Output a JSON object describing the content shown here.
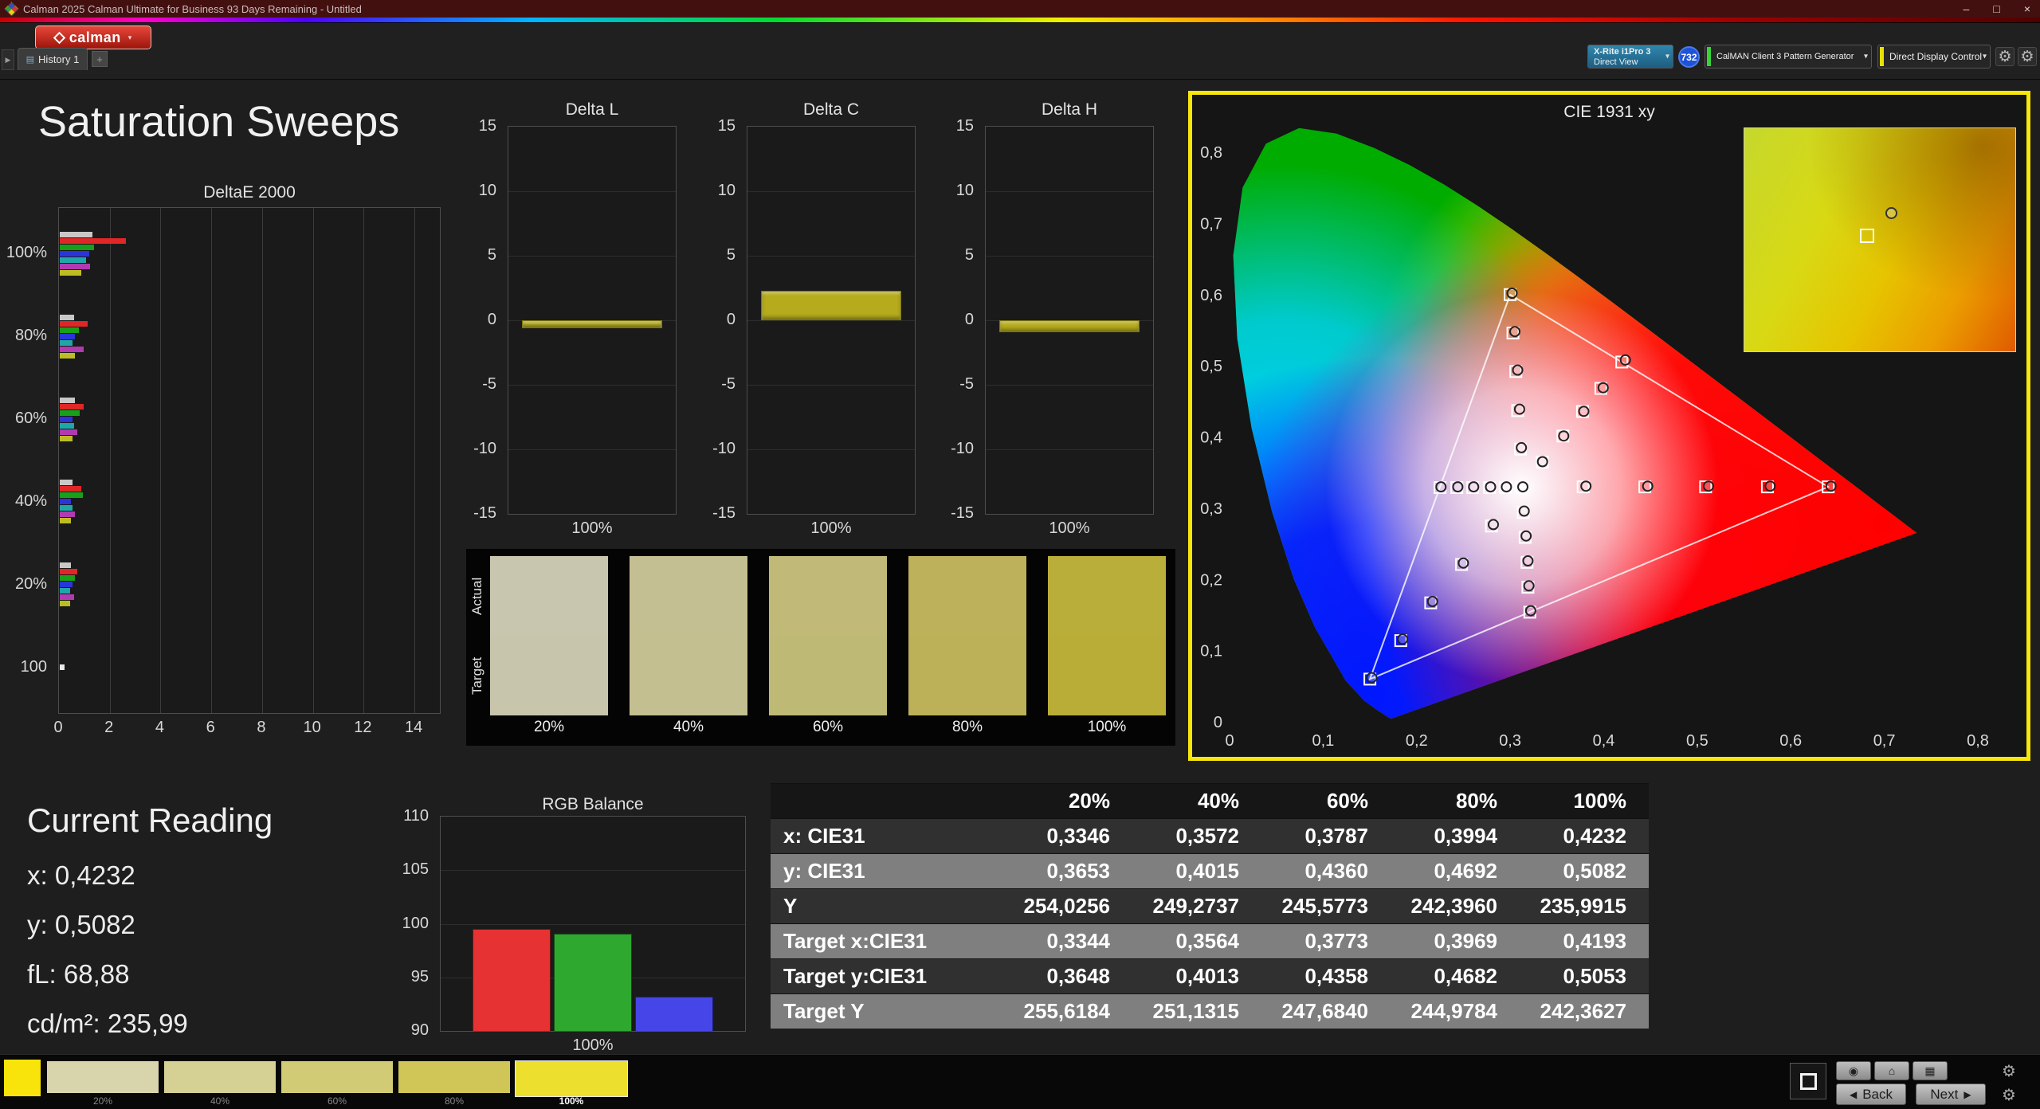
{
  "window": {
    "title": "Calman 2025 Calman Ultimate for Business 93 Days Remaining  - Untitled"
  },
  "icons": {
    "minimize": "–",
    "maximize": "□",
    "close": "×",
    "chevron_down": "▾",
    "panel_arrow": "▶",
    "plus": "+",
    "tab": "▤",
    "gear": "⚙",
    "home": "⌂",
    "target": "◉",
    "grid": "▦",
    "back_arrow": "◀",
    "next_arrow": "▶"
  },
  "toolbar": {
    "logo_text": "calman",
    "history_tab": "History 1",
    "meter": {
      "line1": "X-Rite i1Pro 3",
      "line2": "Direct View",
      "badge": "732"
    },
    "pattern_generator": "CalMAN Client 3 Pattern Generator",
    "display_control": "Direct Display Control"
  },
  "page": {
    "title": "Saturation Sweeps"
  },
  "current_reading": {
    "title": "Current Reading",
    "lines": [
      "x: 0,4232",
      "y: 0,5082",
      "fL: 68,88",
      "cd/m²: 235,99"
    ]
  },
  "comparator": {
    "row_labels": [
      "Actual",
      "Target"
    ],
    "columns": [
      {
        "label": "20%",
        "actual": "#c8c6ae",
        "target": "#c7c5ac"
      },
      {
        "label": "40%",
        "actual": "#c4bf93",
        "target": "#c4bf91"
      },
      {
        "label": "60%",
        "actual": "#c0b978",
        "target": "#bfb976"
      },
      {
        "label": "80%",
        "actual": "#bdb25b",
        "target": "#bcb159"
      },
      {
        "label": "100%",
        "actual": "#baae3a",
        "target": "#b9ad38"
      }
    ]
  },
  "table": {
    "corner": "",
    "headers": [
      "20%",
      "40%",
      "60%",
      "80%",
      "100%"
    ],
    "rows": [
      {
        "label": "x: CIE31",
        "values": [
          "0,3346",
          "0,3572",
          "0,3787",
          "0,3994",
          "0,4232"
        ]
      },
      {
        "label": "y: CIE31",
        "values": [
          "0,3653",
          "0,4015",
          "0,4360",
          "0,4692",
          "0,5082"
        ]
      },
      {
        "label": "Y",
        "values": [
          "254,0256",
          "249,2737",
          "245,5773",
          "242,3960",
          "235,9915"
        ]
      },
      {
        "label": "Target x:CIE31",
        "values": [
          "0,3344",
          "0,3564",
          "0,3773",
          "0,3969",
          "0,4193"
        ]
      },
      {
        "label": "Target y:CIE31",
        "values": [
          "0,3648",
          "0,4013",
          "0,4358",
          "0,4682",
          "0,5053"
        ]
      },
      {
        "label": "Target Y",
        "values": [
          "255,6184",
          "251,1315",
          "247,6840",
          "244,9784",
          "242,3627"
        ]
      }
    ]
  },
  "chart_data": [
    {
      "id": "deltaE2000",
      "type": "bar",
      "title": "DeltaE 2000",
      "orientation": "horizontal",
      "xlim": [
        0,
        15
      ],
      "x_ticks": [
        0,
        2,
        4,
        6,
        8,
        10,
        12,
        14
      ],
      "groups": [
        {
          "label": "100%",
          "bars": [
            {
              "color": "#c8c8c8",
              "value": 1.3
            },
            {
              "color": "#e02626",
              "value": 2.6
            },
            {
              "color": "#18a018",
              "value": 1.35
            },
            {
              "color": "#2a35d8",
              "value": 1.15
            },
            {
              "color": "#1fa7a7",
              "value": 1.05
            },
            {
              "color": "#b13ab1",
              "value": 1.2
            },
            {
              "color": "#bdbd23",
              "value": 0.85
            }
          ]
        },
        {
          "label": "80%",
          "bars": [
            {
              "color": "#c8c8c8",
              "value": 0.55
            },
            {
              "color": "#e02626",
              "value": 1.1
            },
            {
              "color": "#18a018",
              "value": 0.75
            },
            {
              "color": "#2a35d8",
              "value": 0.6
            },
            {
              "color": "#1fa7a7",
              "value": 0.5
            },
            {
              "color": "#b13ab1",
              "value": 0.95
            },
            {
              "color": "#bdbd23",
              "value": 0.6
            }
          ]
        },
        {
          "label": "60%",
          "bars": [
            {
              "color": "#c8c8c8",
              "value": 0.6
            },
            {
              "color": "#e02626",
              "value": 0.95
            },
            {
              "color": "#18a018",
              "value": 0.8
            },
            {
              "color": "#2a35d8",
              "value": 0.5
            },
            {
              "color": "#1fa7a7",
              "value": 0.55
            },
            {
              "color": "#b13ab1",
              "value": 0.7
            },
            {
              "color": "#bdbd23",
              "value": 0.5
            }
          ]
        },
        {
          "label": "40%",
          "bars": [
            {
              "color": "#c8c8c8",
              "value": 0.5
            },
            {
              "color": "#e02626",
              "value": 0.85
            },
            {
              "color": "#18a018",
              "value": 0.9
            },
            {
              "color": "#2a35d8",
              "value": 0.45
            },
            {
              "color": "#1fa7a7",
              "value": 0.5
            },
            {
              "color": "#b13ab1",
              "value": 0.6
            },
            {
              "color": "#bdbd23",
              "value": 0.45
            }
          ]
        },
        {
          "label": "20%",
          "bars": [
            {
              "color": "#c8c8c8",
              "value": 0.45
            },
            {
              "color": "#e02626",
              "value": 0.7
            },
            {
              "color": "#18a018",
              "value": 0.6
            },
            {
              "color": "#2a35d8",
              "value": 0.5
            },
            {
              "color": "#1fa7a7",
              "value": 0.4
            },
            {
              "color": "#b13ab1",
              "value": 0.55
            },
            {
              "color": "#bdbd23",
              "value": 0.4
            }
          ]
        },
        {
          "label": "100",
          "bars": [
            {
              "color": "#e8e8e8",
              "value": 0.2
            }
          ]
        }
      ]
    },
    {
      "id": "deltaL",
      "type": "bar",
      "title": "Delta L",
      "ylim": [
        -15,
        15
      ],
      "y_ticks": [
        15,
        10,
        5,
        0,
        -5,
        -10,
        -15
      ],
      "x_label": "100%",
      "value": -0.6,
      "bar_color": "#b5ab1c"
    },
    {
      "id": "deltaC",
      "type": "bar",
      "title": "Delta C",
      "ylim": [
        -15,
        15
      ],
      "y_ticks": [
        15,
        10,
        5,
        0,
        -5,
        -10,
        -15
      ],
      "x_label": "100%",
      "value": 2.3,
      "bar_color": "#b5ab1c"
    },
    {
      "id": "deltaH",
      "type": "bar",
      "title": "Delta H",
      "ylim": [
        -15,
        15
      ],
      "y_ticks": [
        15,
        10,
        5,
        0,
        -5,
        -10,
        -15
      ],
      "x_label": "100%",
      "value": -0.9,
      "bar_color": "#b5ab1c"
    },
    {
      "id": "rgbBalance",
      "type": "bar",
      "title": "RGB Balance",
      "ylim": [
        90,
        110
      ],
      "y_ticks": [
        110,
        105,
        100,
        95,
        90
      ],
      "x_label": "100%",
      "series": [
        {
          "name": "red",
          "color": "#e63232",
          "value": 99.5
        },
        {
          "name": "green",
          "color": "#2fa82f",
          "value": 99.1
        },
        {
          "name": "blue",
          "color": "#4646e8",
          "value": 93.2
        }
      ]
    },
    {
      "id": "cie1931",
      "type": "scatter",
      "title": "CIE 1931 xy",
      "xlim": [
        0,
        0.8
      ],
      "ylim": [
        0,
        0.8
      ],
      "x_ticks": [
        {
          "v": 0,
          "label": "0"
        },
        {
          "v": 0.1,
          "label": "0,1"
        },
        {
          "v": 0.2,
          "label": "0,2"
        },
        {
          "v": 0.3,
          "label": "0,3"
        },
        {
          "v": 0.4,
          "label": "0,4"
        },
        {
          "v": 0.5,
          "label": "0,5"
        },
        {
          "v": 0.6,
          "label": "0,6"
        },
        {
          "v": 0.7,
          "label": "0,7"
        },
        {
          "v": 0.8,
          "label": "0,8"
        }
      ],
      "y_ticks": [
        {
          "v": 0.8,
          "label": "0,8"
        },
        {
          "v": 0.7,
          "label": "0,7"
        },
        {
          "v": 0.6,
          "label": "0,6"
        },
        {
          "v": 0.5,
          "label": "0,5"
        },
        {
          "v": 0.4,
          "label": "0,4"
        },
        {
          "v": 0.3,
          "label": "0,3"
        },
        {
          "v": 0.2,
          "label": "0,2"
        },
        {
          "v": 0.1,
          "label": "0,1"
        },
        {
          "v": 0,
          "label": "0"
        }
      ],
      "gamut_triangle": [
        [
          0.64,
          0.33
        ],
        [
          0.3,
          0.6
        ],
        [
          0.15,
          0.06
        ]
      ],
      "target_squares": [
        [
          0.378,
          0.33
        ],
        [
          0.444,
          0.33
        ],
        [
          0.509,
          0.33
        ],
        [
          0.575,
          0.33
        ],
        [
          0.64,
          0.33
        ],
        [
          0.311,
          0.383
        ],
        [
          0.308,
          0.437
        ],
        [
          0.306,
          0.492
        ],
        [
          0.303,
          0.546
        ],
        [
          0.3,
          0.6
        ],
        [
          0.28,
          0.275
        ],
        [
          0.248,
          0.221
        ],
        [
          0.215,
          0.167
        ],
        [
          0.183,
          0.114
        ],
        [
          0.15,
          0.06
        ],
        [
          0.295,
          0.329
        ],
        [
          0.278,
          0.329
        ],
        [
          0.26,
          0.329
        ],
        [
          0.243,
          0.329
        ],
        [
          0.225,
          0.329
        ],
        [
          0.314,
          0.294
        ],
        [
          0.316,
          0.259
        ],
        [
          0.318,
          0.224
        ],
        [
          0.319,
          0.189
        ],
        [
          0.321,
          0.154
        ],
        [
          0.3344,
          0.3648
        ],
        [
          0.3564,
          0.4013
        ],
        [
          0.3773,
          0.4358
        ],
        [
          0.3969,
          0.4682
        ],
        [
          0.4193,
          0.5053
        ],
        [
          0.3127,
          0.329
        ]
      ],
      "measured_circles": [
        [
          0.381,
          0.331
        ],
        [
          0.447,
          0.331
        ],
        [
          0.512,
          0.331
        ],
        [
          0.578,
          0.331
        ],
        [
          0.643,
          0.331
        ],
        [
          0.312,
          0.385
        ],
        [
          0.31,
          0.439
        ],
        [
          0.308,
          0.494
        ],
        [
          0.305,
          0.548
        ],
        [
          0.302,
          0.602
        ],
        [
          0.282,
          0.277
        ],
        [
          0.25,
          0.223
        ],
        [
          0.217,
          0.169
        ],
        [
          0.185,
          0.116
        ],
        [
          0.152,
          0.062
        ],
        [
          0.296,
          0.33
        ],
        [
          0.279,
          0.33
        ],
        [
          0.261,
          0.33
        ],
        [
          0.244,
          0.33
        ],
        [
          0.226,
          0.33
        ],
        [
          0.315,
          0.296
        ],
        [
          0.317,
          0.261
        ],
        [
          0.319,
          0.226
        ],
        [
          0.32,
          0.191
        ],
        [
          0.322,
          0.156
        ],
        [
          0.3346,
          0.3653
        ],
        [
          0.3572,
          0.4015
        ],
        [
          0.3787,
          0.436
        ],
        [
          0.3994,
          0.4692
        ],
        [
          0.4232,
          0.5082
        ],
        [
          0.3135,
          0.33
        ]
      ],
      "inset": {
        "square": [
          0.45,
          0.48
        ],
        "circle": [
          0.54,
          0.38
        ]
      }
    }
  ],
  "pattern_strip": {
    "active_color": "#f8e40a",
    "swatches": [
      {
        "label": "20%",
        "color": "#d8d5ad",
        "selected": false
      },
      {
        "label": "40%",
        "color": "#d5d093",
        "selected": false
      },
      {
        "label": "60%",
        "color": "#d2cb76",
        "selected": false
      },
      {
        "label": "80%",
        "color": "#d0c658",
        "selected": false
      },
      {
        "label": "100%",
        "color": "#ecdf2e",
        "selected": true
      }
    ]
  },
  "nav": {
    "back": "Back",
    "next": "Next"
  }
}
